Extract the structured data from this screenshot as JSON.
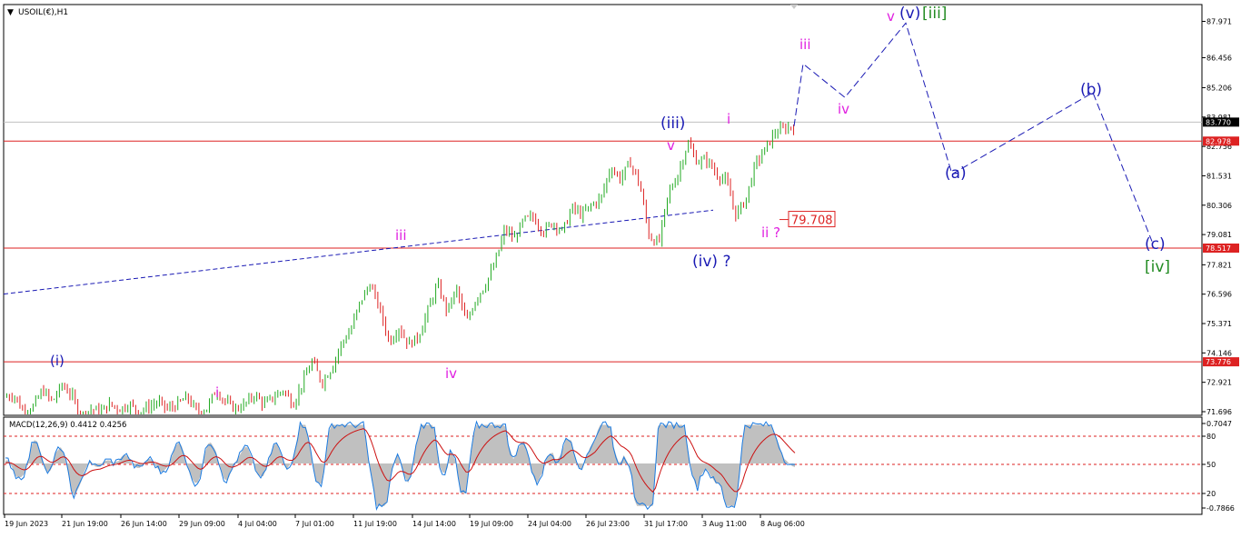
{
  "window": {
    "symbol_label": "USOIL(€),H1",
    "collapse_marker": "▼"
  },
  "indicator": {
    "label": "MACD(12,26,9) 0.4412 0.4256"
  },
  "colors": {
    "bull": "#22aa22",
    "bear": "#dd2222",
    "hline": "#dd2222",
    "wave_blue": "#1a1ab4",
    "wave_magenta": "#e020e0",
    "wave_green": "#228b22",
    "price_tag": "#000000",
    "level_tag": "#dd2222",
    "macd_hist": "#c0c0c0",
    "macd_line": "#1a7ae0",
    "signal": "#cc1111"
  },
  "chart_data": [
    {
      "type": "line",
      "title": "USOIL(€),H1",
      "y_ticks": [
        "87.971",
        "86.456",
        "85.206",
        "83.981",
        "82.756",
        "81.531",
        "80.306",
        "79.081",
        "77.821",
        "76.596",
        "75.371",
        "74.146",
        "72.921",
        "71.696"
      ],
      "x_ticks": [
        "19 Jun 2023",
        "21 Jun 19:00",
        "26 Jun 14:00",
        "29 Jun 09:00",
        "4 Jul 04:00",
        "7 Jul 01:00",
        "11 Jul 19:00",
        "14 Jul 14:00",
        "19 Jul 09:00",
        "24 Jul 04:00",
        "26 Jul 23:00",
        "31 Jul 17:00",
        "3 Aug 11:00",
        "8 Aug 06:00"
      ],
      "ylim": [
        71.5,
        88.4
      ],
      "current_price": {
        "value": 83.77,
        "label": "83.770"
      },
      "horizontal_levels": [
        {
          "value": 82.978,
          "label": "82.978"
        },
        {
          "value": 78.517,
          "label": "78.517"
        },
        {
          "value": 73.776,
          "label": "73.776"
        }
      ],
      "price_path": [
        72.3,
        72.4,
        71.7,
        71.9,
        72.6,
        72.1,
        72.8,
        72.4,
        71.5,
        71.8,
        71.7,
        72.0,
        71.8,
        72.0,
        71.7,
        71.9,
        72.1,
        71.8,
        72.0,
        72.3,
        71.7,
        71.8,
        72.6,
        72.1,
        71.8,
        72.0,
        72.4,
        72.0,
        72.3,
        72.6,
        72.0,
        72.9,
        73.8,
        72.9,
        73.5,
        74.5,
        75.1,
        76.3,
        77.0,
        76.0,
        74.6,
        75.2,
        74.5,
        74.8,
        75.9,
        77.0,
        75.9,
        76.8,
        75.4,
        76.4,
        77.0,
        77.9,
        79.3,
        78.9,
        79.7,
        79.8,
        79.2,
        79.6,
        79.2,
        80.2,
        79.9,
        80.3,
        80.6,
        81.9,
        81.4,
        82.1,
        81.2,
        79.0,
        78.7,
        80.8,
        81.6,
        82.9,
        82.1,
        82.2,
        81.6,
        81.3,
        79.9,
        80.5,
        82.0,
        82.6,
        83.3,
        83.5,
        83.6
      ],
      "price_path_x_span": [
        "19 Jun 2023",
        "8 Aug 06:00"
      ],
      "trendline": {
        "from": 76.6,
        "to": 80.1
      },
      "annotation_label": "79.708",
      "forecast_path": [
        {
          "x": "8 Aug 06:00",
          "y": 83.6
        },
        {
          "x": "iii",
          "y": 86.2
        },
        {
          "x": "iv",
          "y": 84.8
        },
        {
          "x": "v",
          "y": 87.9
        },
        {
          "x": "(a)",
          "y": 81.6
        },
        {
          "x": "(b)",
          "y": 85.0
        },
        {
          "x": "(c)",
          "y": 78.8
        }
      ],
      "wave_labels": [
        {
          "text": "(i)",
          "color": "blue"
        },
        {
          "text": "i",
          "color": "magenta"
        },
        {
          "text": "iii",
          "color": "magenta"
        },
        {
          "text": "iv",
          "color": "magenta"
        },
        {
          "text": "(iii)",
          "color": "blue"
        },
        {
          "text": "v",
          "color": "magenta"
        },
        {
          "text": "(iv) ?",
          "color": "blue"
        },
        {
          "text": "i",
          "color": "magenta"
        },
        {
          "text": "ii ?",
          "color": "magenta"
        },
        {
          "text": "iii",
          "color": "magenta"
        },
        {
          "text": "iv",
          "color": "magenta"
        },
        {
          "text": "v",
          "color": "magenta"
        },
        {
          "text": "(v)",
          "color": "blue"
        },
        {
          "text": "[iii]",
          "color": "green"
        },
        {
          "text": "(a)",
          "color": "blue"
        },
        {
          "text": "(b)",
          "color": "blue"
        },
        {
          "text": "(c)",
          "color": "blue"
        },
        {
          "text": "[iv]",
          "color": "green"
        }
      ]
    },
    {
      "type": "area",
      "title": "MACD(12,26,9) 0.4412 0.4256",
      "y_ticks": [
        "0.7047",
        "80",
        "50",
        "20",
        "-0.7866"
      ],
      "ylim": [
        -0.79,
        0.705
      ],
      "levels": [
        80,
        50,
        20
      ]
    }
  ]
}
